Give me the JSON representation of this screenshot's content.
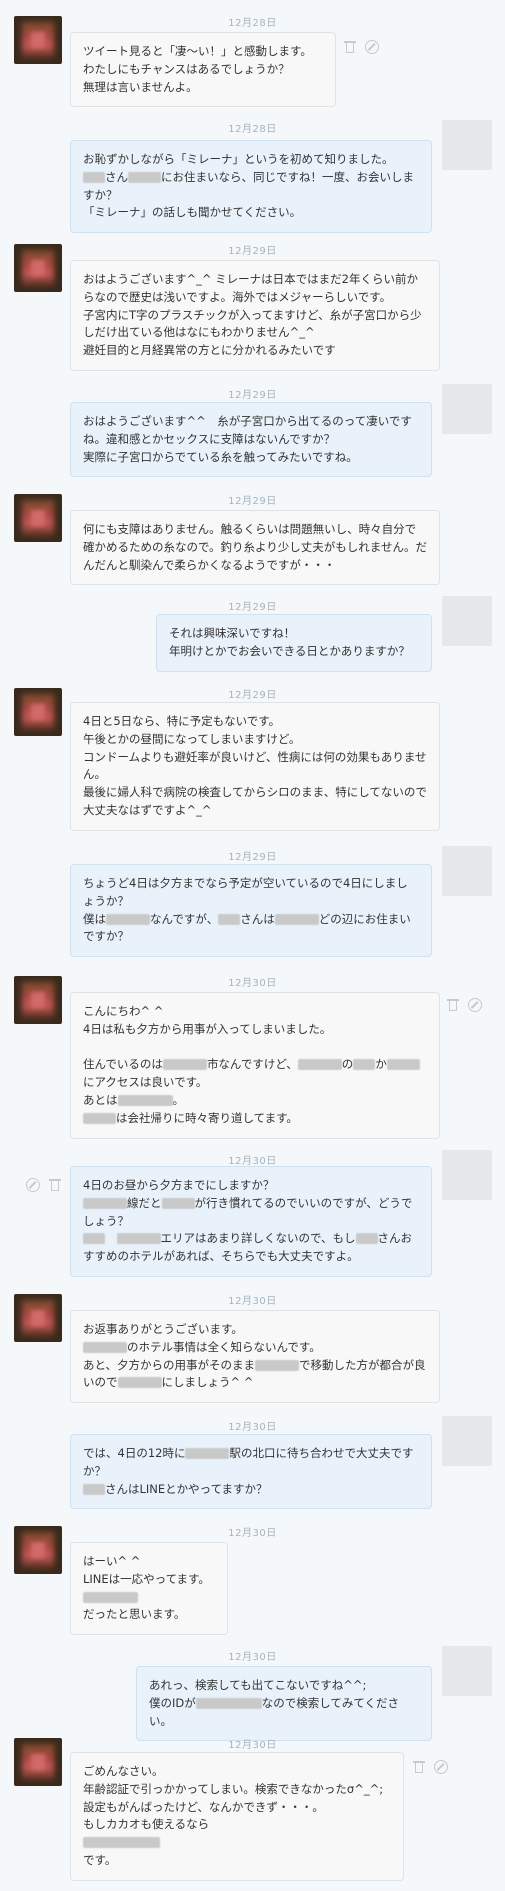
{
  "messages": [
    {
      "date": "12月28日",
      "side": "them",
      "lines": [
        "ツイート見ると「凄〜い！」と感動します。",
        "わたしにもチャンスはあるでしょうか？",
        "無理は言いませんよ。"
      ]
    },
    {
      "date": "12月28日",
      "side": "me",
      "lines": [
        "お恥ずかしながら「ミレーナ」というを初めて知りました。",
        "▒▒さん▒▒▒にお住まいなら、同じですね！一度、お会いしますか？",
        "「ミレーナ」の話しも聞かせてください。"
      ]
    },
    {
      "date": "12月29日",
      "side": "them",
      "lines": [
        "おはようございます^_^ ミレーナは日本ではまだ2年くらい前からなので歴史は浅いですよ。海外ではメジャーらしいです。",
        "子宮内にT字のプラスチックが入ってますけど、糸が子宮口から少しだけ出ている他はなにもわかりません^_^",
        "避妊目的と月経異常の方とに分かれるみたいです"
      ]
    },
    {
      "date": "12月29日",
      "side": "me",
      "lines": [
        "おはようございます^^　糸が子宮口から出てるのって凄いですね。違和感とかセックスに支障はないんですか？",
        "実際に子宮口からでている糸を触ってみたいですね。"
      ]
    },
    {
      "date": "12月29日",
      "side": "them",
      "lines": [
        "何にも支障はありません。触るくらいは問題無いし、時々自分で確かめるための糸なので。釣り糸より少し丈夫がもしれません。だんだんと馴染んで柔らかくなるようですが・・・"
      ]
    },
    {
      "date": "12月29日",
      "side": "me",
      "lines": [
        "それは興味深いですね！",
        "年明けとかでお会いできる日とかありますか？"
      ]
    },
    {
      "date": "12月29日",
      "side": "them",
      "lines": [
        "4日と5日なら、特に予定もないです。",
        "午後とかの昼間になってしまいますけど。",
        "コンドームよりも避妊率が良いけど、性病には何の効果もありません。",
        "最後に婦人科で病院の検査してからシロのまま、特にしてないので大丈夫なはずですよ^_^"
      ]
    },
    {
      "date": "12月29日",
      "side": "me",
      "lines": [
        "ちょうど4日は夕方までなら予定が空いているので4日にしましょうか？",
        "僕は▒▒▒▒なんですが、▒▒さんは▒▒▒▒どの辺にお住まいですか？"
      ]
    },
    {
      "date": "12月30日",
      "side": "them",
      "lines": [
        "こんにちわ^ ^",
        "4日は私も夕方から用事が入ってしまいました。",
        "",
        "住んでいるのは▒▒▒▒市なんですけど、▒▒▒▒の▒▒か▒▒▒にアクセスは良いです。",
        "あとは▒▒▒▒▒。",
        "▒▒▒は会社帰りに時々寄り道してます。"
      ]
    },
    {
      "date": "12月30日",
      "side": "me",
      "lines": [
        "4日のお昼から夕方までにしますか？",
        "▒▒▒▒線だと▒▒▒が行き慣れてるのでいいのですが、どうでしょう？",
        "▒▒　▒▒▒▒エリアはあまり詳しくないので、もし▒▒さんおすすめのホテルがあれば、そちらでも大丈夫ですよ。"
      ]
    },
    {
      "date": "12月30日",
      "side": "them",
      "lines": [
        "お返事ありがとうございます。",
        "▒▒▒▒のホテル事情は全く知らないんです。",
        "あと、夕方からの用事がそのまま▒▒▒▒で移動した方が都合が良いので▒▒▒▒にしましょう^ ^"
      ]
    },
    {
      "date": "12月30日",
      "side": "me",
      "lines": [
        "では、4日の12時に▒▒▒▒駅の北口に待ち合わせで大丈夫ですか？",
        "▒▒さんはLINEとかやってますか？"
      ]
    },
    {
      "date": "12月30日",
      "side": "them",
      "lines": [
        "はーい^ ^",
        "LINEは一応やってます。",
        "▒▒▒▒▒",
        "だったと思います。"
      ]
    },
    {
      "date": "12月30日",
      "side": "me",
      "lines": [
        "あれっ、検索しても出てこないですね^^;",
        "僕のIDが▒▒▒▒▒▒なので検索してみてください。"
      ]
    },
    {
      "date": "12月30日",
      "side": "them",
      "lines": [
        "ごめんなさい。",
        "年齢認証で引っかかってしまい。検索できなかったσ^_^;",
        "設定もがんばったけど、なんかできず・・・。",
        "もしカカオも使えるなら",
        "▒▒▒▒▒▒▒",
        "です。"
      ]
    }
  ]
}
